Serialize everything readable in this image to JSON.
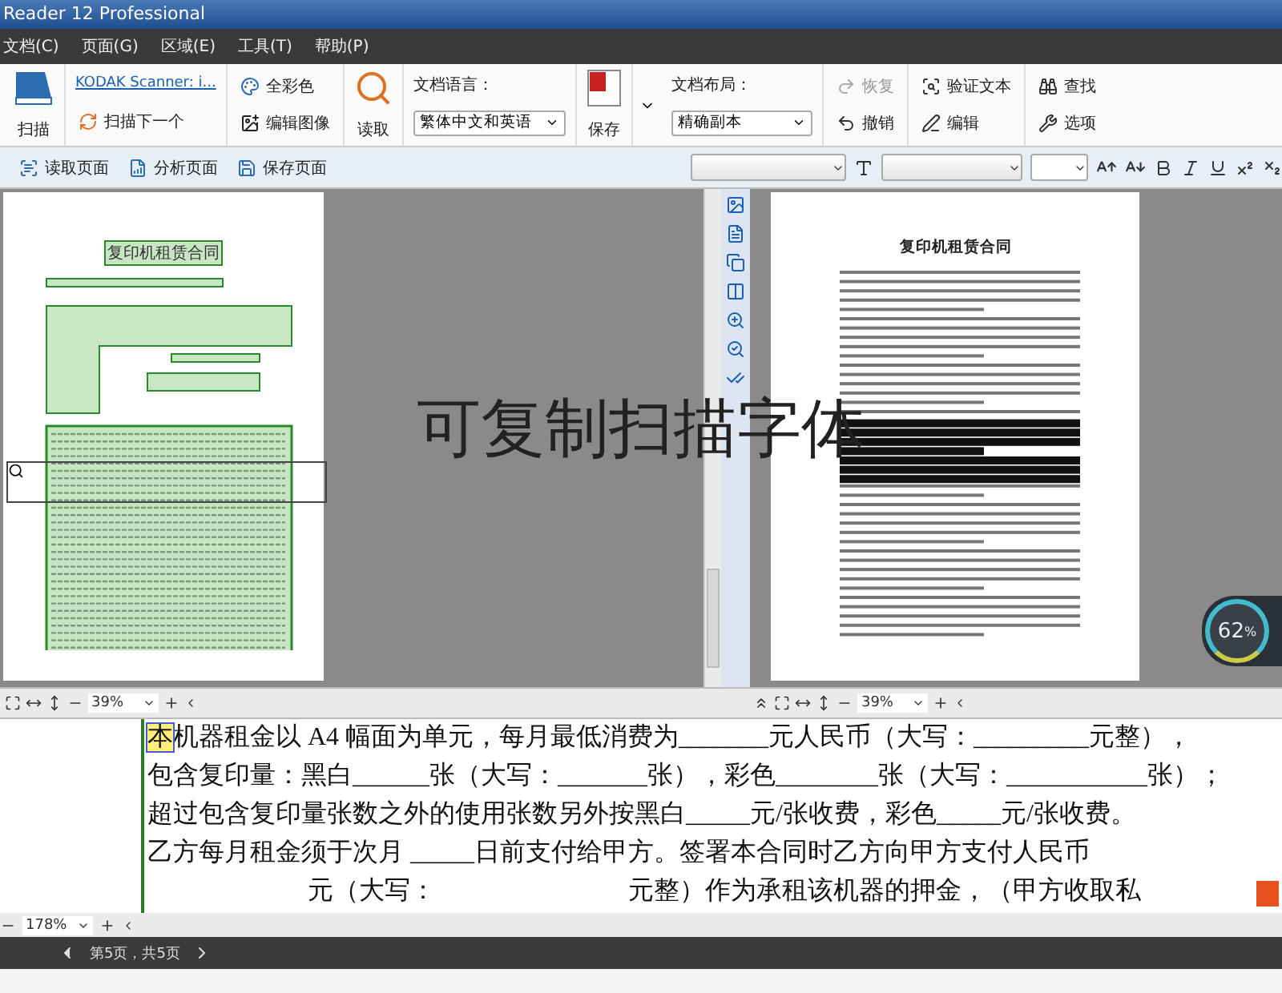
{
  "window": {
    "title": "Reader 12 Professional"
  },
  "menu": [
    "文档(C)",
    "页面(G)",
    "区域(E)",
    "工具(T)",
    "帮助(P)"
  ],
  "ribbon": {
    "scan": "扫描",
    "scanner_link": "KODAK Scanner: i...",
    "scan_next": "扫描下一个",
    "color_mode": "全彩色",
    "edit_image": "编辑图像",
    "read": "读取",
    "language": {
      "label": "文档语言：",
      "value": "繁体中文和英语"
    },
    "save": "保存",
    "layout": {
      "label": "文档布局：",
      "value": "精确副本"
    },
    "actions": [
      {
        "kind": "redo",
        "label": "恢复",
        "disabled": true
      },
      {
        "kind": "undo",
        "label": "撤销",
        "disabled": false
      },
      {
        "kind": "verify",
        "label": "验证文本",
        "disabled": false
      },
      {
        "kind": "edit",
        "label": "编辑",
        "disabled": false
      },
      {
        "kind": "find",
        "label": "查找",
        "disabled": false
      },
      {
        "kind": "options",
        "label": "选项",
        "disabled": false
      }
    ]
  },
  "page_toolbar": [
    {
      "kind": "read",
      "label": "读取页面"
    },
    {
      "kind": "analyze",
      "label": "分析页面"
    },
    {
      "kind": "save",
      "label": "保存页面"
    }
  ],
  "left_pane": {
    "page_title": "复印机租赁合同",
    "zoom": "39%"
  },
  "right_pane": {
    "page_title": "复印机租赁合同",
    "zoom": "39%"
  },
  "overlay_caption": "可复制扫描字体",
  "cpu_widget": {
    "reading": "62",
    "unit": "%"
  },
  "editor": {
    "highlighted_char": "本",
    "zoom": "178%",
    "lines": [
      {
        "text": "机器租金以 A4 幅面为单元，每月最低消费为_______元人民币（大写：_________元整），",
        "indented": false
      },
      {
        "text": "包含复印量：黑白______张（大写：_______张），彩色________张（大写：___________张）；",
        "indented": false
      },
      {
        "text": "超过包含复印量张数之外的使用张数另外按黑白_____元/张收费，彩色_____元/张收费。",
        "indented": false
      },
      {
        "text": "乙方每月租金须于次月 _____日前支付给甲方。签署本合同时乙方向甲方支付人民币",
        "indented": false
      },
      {
        "text": "元（大写：                              元整）作为承租该机器的押金，（甲方收取私",
        "indented": true
      }
    ]
  },
  "status_bar": {
    "page": "第5页，共5页"
  }
}
